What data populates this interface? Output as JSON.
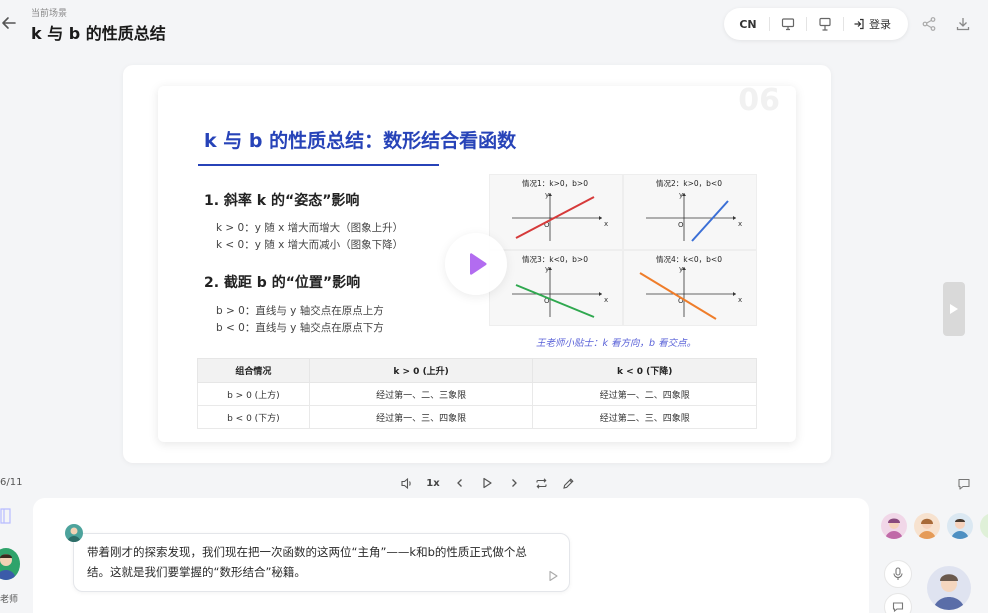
{
  "header": {
    "scene_label": "当前场景",
    "title": "k 与 b 的性质总结",
    "lang": "CN",
    "login": "登录"
  },
  "slide": {
    "number": "06",
    "title": "k 与 b 的性质总结：数形结合看函数",
    "section1": {
      "heading": "1. 斜率 k 的“姿态”影响",
      "lines": [
        "k > 0：y 随 x 增大而增大（图象上升）",
        "k < 0：y 随 x 增大而减小（图象下降）"
      ]
    },
    "section2": {
      "heading": "2. 截距 b 的“位置”影响",
      "lines": [
        "b > 0：直线与 y 轴交点在原点上方",
        "b < 0：直线与 y 轴交点在原点下方"
      ]
    },
    "graphs": [
      {
        "label": "情况1：k>0，b>0",
        "color": "#d63a3a"
      },
      {
        "label": "情况2：k>0，b<0",
        "color": "#3b6fd6"
      },
      {
        "label": "情况3：k<0，b>0",
        "color": "#2fa84f"
      },
      {
        "label": "情况4：k<0，b<0",
        "color": "#ef7d2a"
      }
    ],
    "axis": {
      "x": "x",
      "y": "y",
      "origin": "O"
    },
    "tip": "王老师小贴士：k 看方向，b 看交点。",
    "table": {
      "headers": [
        "组合情况",
        "k > 0 (上升)",
        "k < 0 (下降)"
      ],
      "rows": [
        [
          "b > 0 (上方)",
          "经过第一、二、三象限",
          "经过第一、二、四象限"
        ],
        [
          "b < 0 (下方)",
          "经过第一、三、四象限",
          "经过第二、三、四象限"
        ]
      ]
    }
  },
  "controls": {
    "page_counter": "6/11",
    "speed": "1x"
  },
  "chat": {
    "message": "带着刚才的探索发现，我们现在把一次函数的这两位“主角”——k和b的性质正式做个总结。这就是我们要掌握的“数形结合”秘籍。",
    "teacher_label": "老师"
  },
  "colors": {
    "accent": "#2743b8",
    "tip": "#5a62d8"
  }
}
